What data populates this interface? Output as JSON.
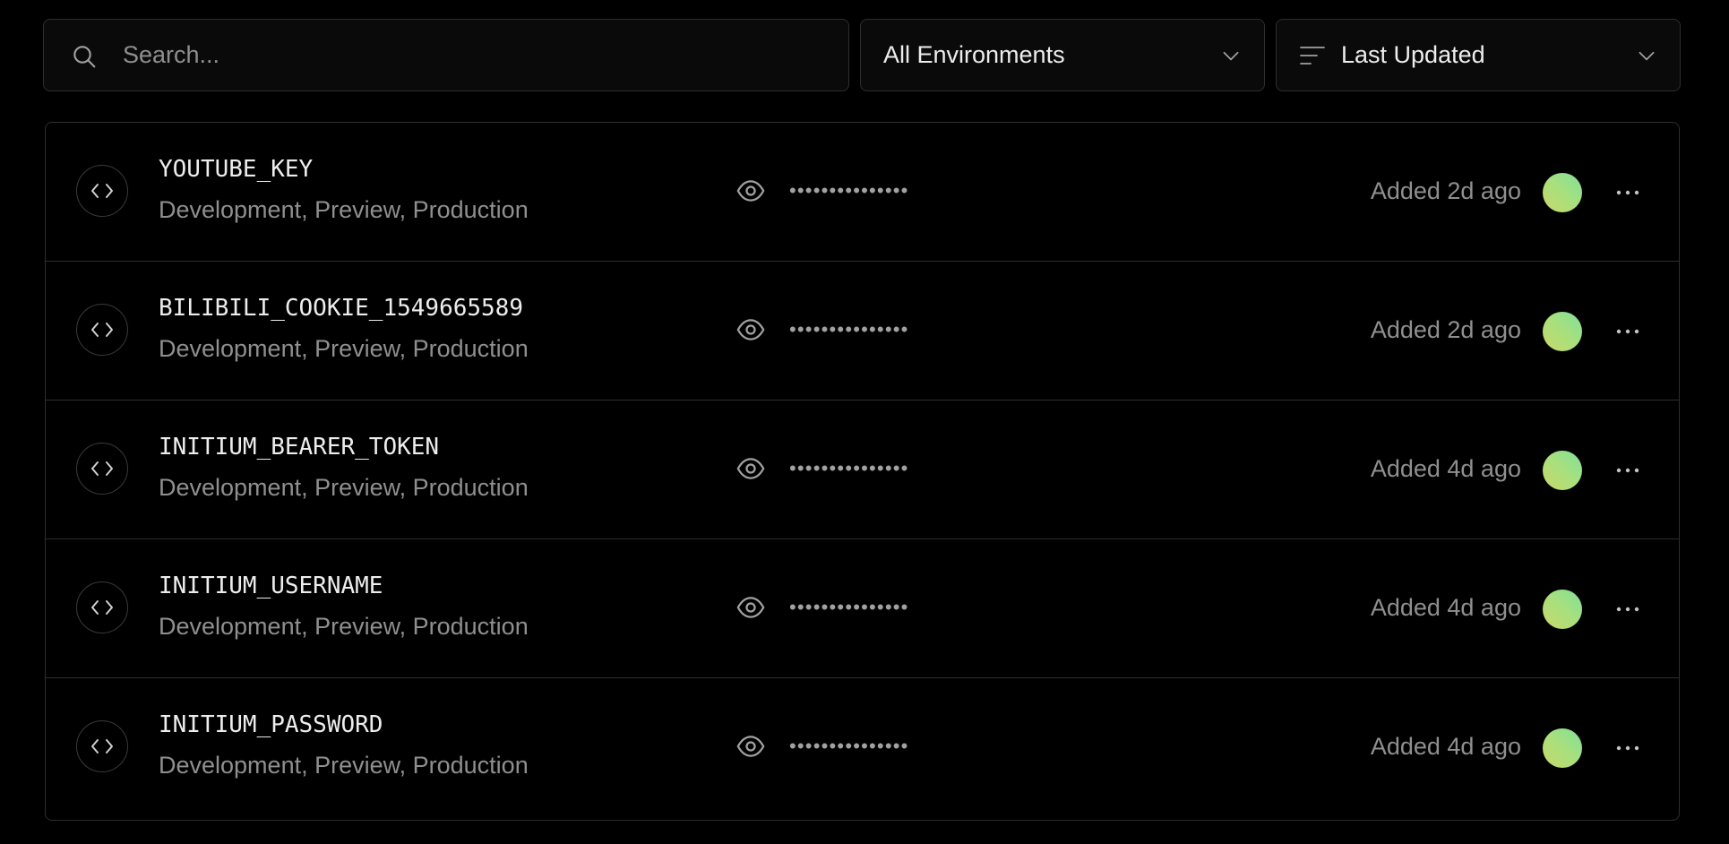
{
  "toolbar": {
    "search": {
      "placeholder": "Search...",
      "value": "",
      "icon": "search-icon"
    },
    "environment_filter": {
      "selected": "All Environments",
      "icon": "chevron-down-icon"
    },
    "sort": {
      "selected": "Last Updated",
      "icons": [
        "sort-lines-icon",
        "chevron-down-icon"
      ]
    }
  },
  "variables": [
    {
      "name": "YOUTUBE_KEY",
      "environments": "Development, Preview, Production",
      "masked_value": "•••••••••••••••",
      "added": "Added 2d ago"
    },
    {
      "name": "BILIBILI_COOKIE_1549665589",
      "environments": "Development, Preview, Production",
      "masked_value": "•••••••••••••••",
      "added": "Added 2d ago"
    },
    {
      "name": "INITIUM_BEARER_TOKEN",
      "environments": "Development, Preview, Production",
      "masked_value": "•••••••••••••••",
      "added": "Added 4d ago"
    },
    {
      "name": "INITIUM_USERNAME",
      "environments": "Development, Preview, Production",
      "masked_value": "•••••••••••••••",
      "added": "Added 4d ago"
    },
    {
      "name": "INITIUM_PASSWORD",
      "environments": "Development, Preview, Production",
      "masked_value": "•••••••••••••••",
      "added": "Added 4d ago"
    }
  ],
  "colors": {
    "background": "#000000",
    "border": "#2e2e2e",
    "text_primary": "#ededed",
    "text_secondary": "#8f8f8f",
    "avatar_gradient": [
      "#c8d96a",
      "#7fe09a"
    ]
  }
}
